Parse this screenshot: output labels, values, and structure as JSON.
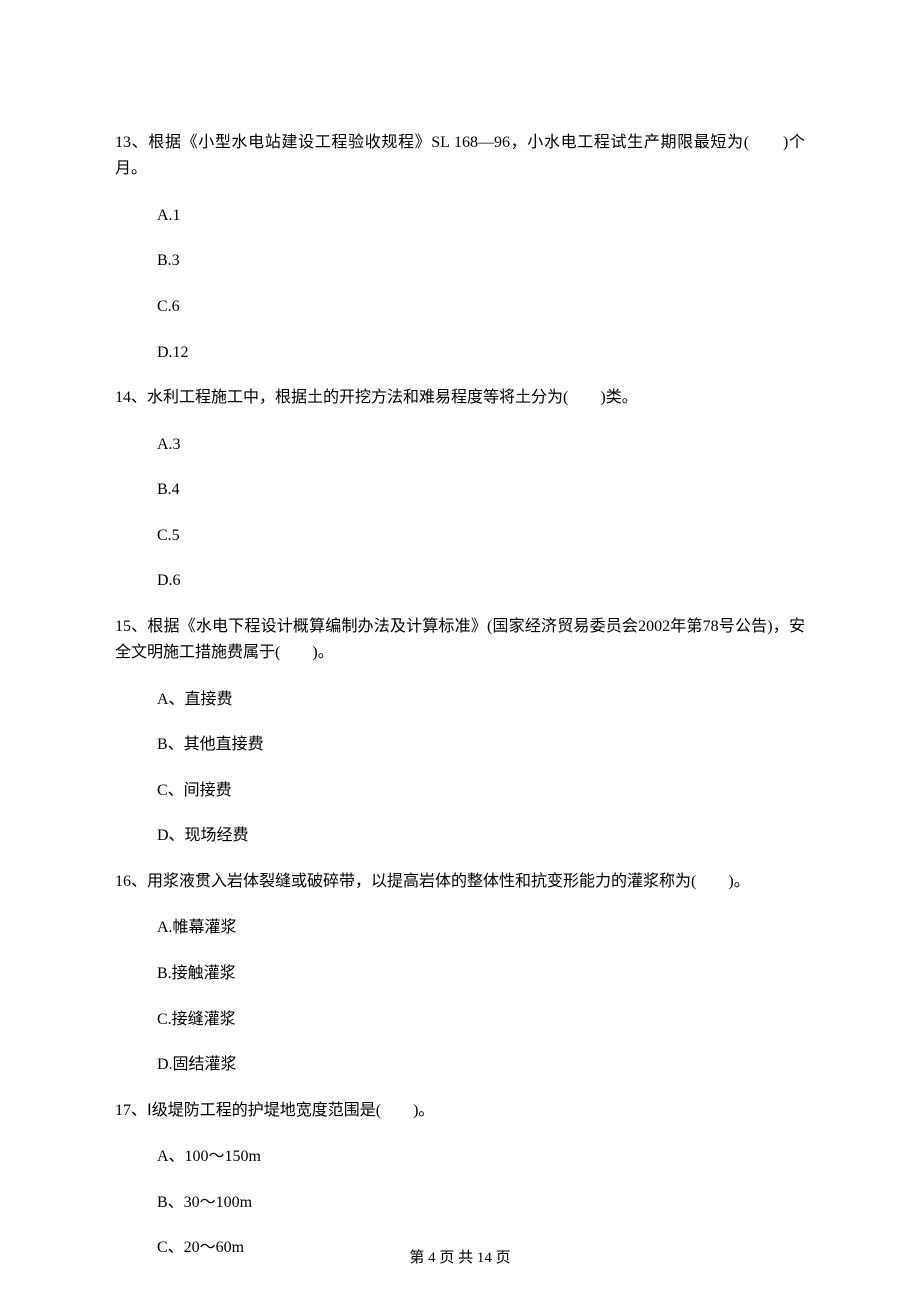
{
  "blank": "(　　)",
  "questions": [
    {
      "num": "13",
      "stem_pre": "13、根据《小型水电站建设工程验收规程》SL 168—96，小水电工程试生产期限最短为",
      "stem_post": "个月。",
      "options": [
        "A.1",
        "B.3",
        "C.6",
        "D.12"
      ]
    },
    {
      "num": "14",
      "stem_pre": "14、水利工程施工中，根据土的开挖方法和难易程度等将土分为",
      "stem_post": "类。",
      "options": [
        "A.3",
        "B.4",
        "C.5",
        "D.6"
      ]
    },
    {
      "num": "15",
      "stem_pre": "15、根据《水电下程设计概算编制办法及计算标准》(国家经济贸易委员会2002年第78号公告)，安全文明施工措施费属于",
      "stem_post": "。",
      "options": [
        "A、直接费",
        "B、其他直接费",
        "C、间接费",
        "D、现场经费"
      ]
    },
    {
      "num": "16",
      "stem_pre": "16、用浆液贯入岩体裂缝或破碎带，以提高岩体的整体性和抗变形能力的灌浆称为",
      "stem_post": "。",
      "options": [
        "A.帷幕灌浆",
        "B.接触灌浆",
        "C.接缝灌浆",
        "D.固结灌浆"
      ]
    },
    {
      "num": "17",
      "stem_pre": "17、Ⅰ级堤防工程的护堤地宽度范围是",
      "stem_post": "。",
      "options": [
        "A、100～150m",
        "B、30～100m",
        "C、20～60m"
      ]
    }
  ],
  "footer": "第 4 页 共 14 页"
}
